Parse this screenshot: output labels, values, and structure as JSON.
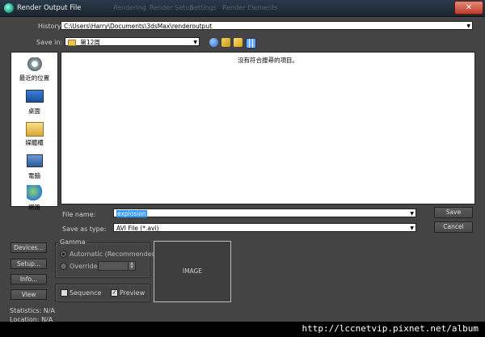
{
  "window": {
    "title": "Render Output File",
    "ghost_menu": [
      "Rendering",
      "Render Setup",
      "Settings",
      "Render Elements"
    ]
  },
  "history": {
    "label": "History:",
    "value": "C:\\Users\\Harry\\Documents\\3dsMax\\renderoutput"
  },
  "save_in": {
    "label": "Save in:",
    "value": "第12周"
  },
  "places": [
    {
      "label": "最近的位置",
      "icon": "recent-places-icon"
    },
    {
      "label": "桌面",
      "icon": "desktop-icon"
    },
    {
      "label": "媒體櫃",
      "icon": "libraries-icon"
    },
    {
      "label": "電腦",
      "icon": "computer-icon"
    },
    {
      "label": "網路",
      "icon": "network-icon"
    }
  ],
  "file_list": {
    "empty_message": "沒有符合搜尋的項目。"
  },
  "file_name": {
    "label": "File name:",
    "value": "explosion"
  },
  "save_as_type": {
    "label": "Save as type:",
    "value": "AVI File (*.avi)"
  },
  "buttons": {
    "save": "Save",
    "cancel": "Cancel",
    "devices": "Devices...",
    "setup": "Setup...",
    "info": "Info...",
    "view": "View"
  },
  "gamma": {
    "label": "Gamma",
    "automatic": "Automatic (Recommended)",
    "override": "Override",
    "selected": "automatic"
  },
  "options": {
    "sequence": "Sequence",
    "sequence_checked": false,
    "preview": "Preview",
    "preview_checked": true
  },
  "image_preview": {
    "label": "IMAGE"
  },
  "stats": {
    "statistics": "Statistics: N/A",
    "location": "Location: N/A"
  },
  "watermark": "http://lccnetvip.pixnet.net/album",
  "colors": {
    "title_bar": "#1f2a35",
    "close_button": "#c0392b",
    "panel": "#444444",
    "selection": "#3399ff"
  }
}
